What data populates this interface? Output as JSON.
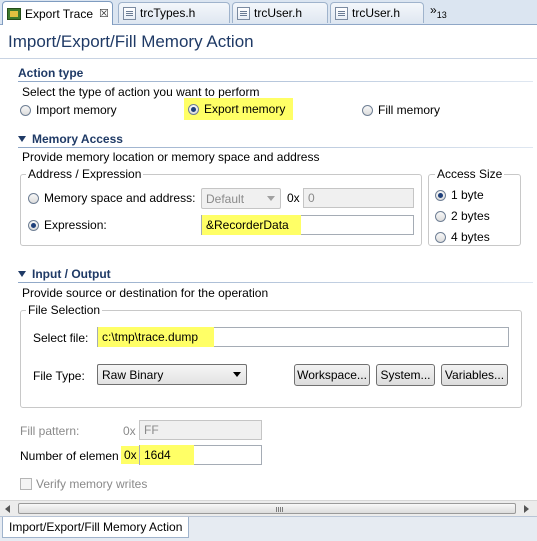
{
  "tabs": [
    {
      "label": "Export Trace",
      "close": "☒",
      "icon": "board-icon"
    },
    {
      "label": "trcTypes.h",
      "icon": "document-icon"
    },
    {
      "label": "trcUser.h",
      "icon": "document-icon"
    },
    {
      "label": "trcUser.h",
      "icon": "document-icon"
    }
  ],
  "overflow": {
    "arrows": "»",
    "count": "13"
  },
  "title": "Import/Export/Fill Memory Action",
  "action_type": {
    "header": "Action type",
    "description": "Select the type of action you want to perform",
    "options": [
      "Import memory",
      "Export memory",
      "Fill memory"
    ],
    "selected": "Export memory"
  },
  "memory_access": {
    "header": "Memory Access",
    "description": "Provide memory location or memory space and address",
    "address_group": "Address / Expression",
    "space_label": "Memory space and address:",
    "space_select": "Default",
    "hex_prefix": "0x",
    "space_address": "0",
    "expression_label": "Expression:",
    "expression_value": "&RecorderData",
    "access_size": {
      "label": "Access Size",
      "options": [
        "1 byte",
        "2 bytes",
        "4 bytes"
      ],
      "selected": "1 byte"
    }
  },
  "input_output": {
    "header": "Input / Output",
    "description": "Provide source or destination for the operation",
    "file_group": "File Selection",
    "select_file_label": "Select file:",
    "select_file_value": "c:\\tmp\\trace.dump",
    "file_type_label": "File Type:",
    "file_type_value": "Raw Binary",
    "buttons": [
      "Workspace...",
      "System...",
      "Variables..."
    ]
  },
  "fill_pattern": {
    "label": "Fill pattern:",
    "prefix": "0x",
    "value": "FF"
  },
  "number_of_elements": {
    "label": "Number of elemen",
    "prefix": "0x",
    "value": "16d4"
  },
  "verify": {
    "label": "Verify memory writes",
    "checked": false
  },
  "bottom_tab": "Import/Export/Fill Memory Action",
  "colors": {
    "highlight": "#ffff66",
    "header_blue": "#1f3a66"
  }
}
